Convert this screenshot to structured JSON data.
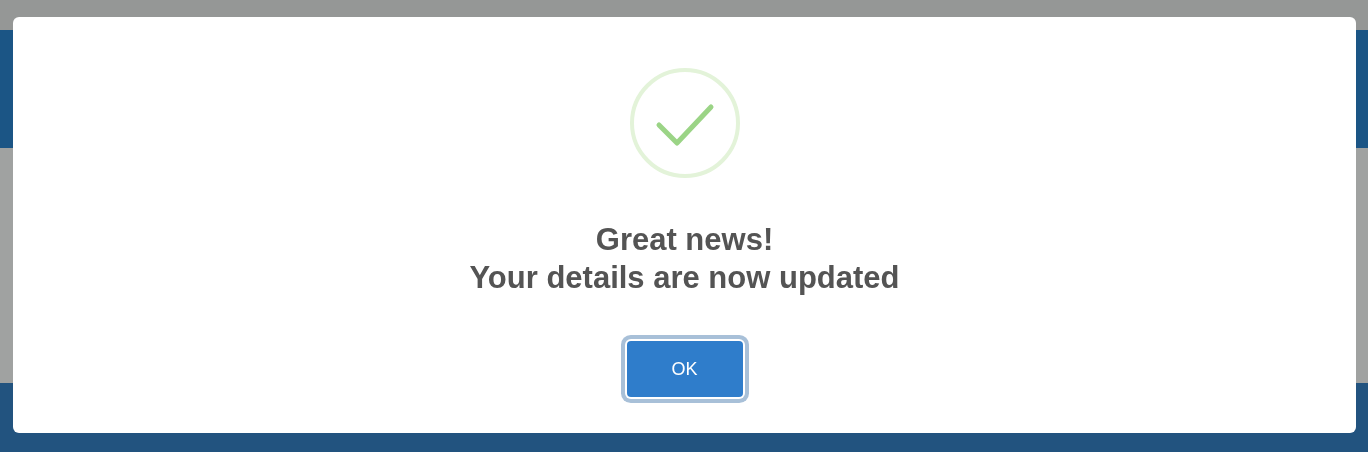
{
  "dialog": {
    "kind": "success",
    "title": "Great news!",
    "message": "Your details are now updated",
    "buttons": [
      {
        "label": "OK",
        "focused": true
      }
    ]
  }
}
